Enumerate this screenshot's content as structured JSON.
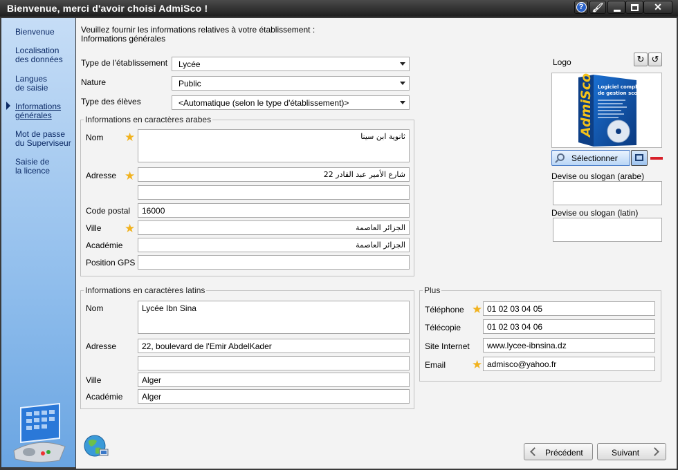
{
  "window": {
    "title": "Bienvenue, merci d'avoir choisi AdmiSco !"
  },
  "titlebar_icons": [
    "help-icon",
    "skin-brush-icon",
    "minimize-icon",
    "maximize-icon",
    "close-icon"
  ],
  "help_glyph": "?",
  "skin_glyph": "🖌",
  "close_glyph": "✕",
  "sidebar": {
    "items": [
      {
        "line1": "Bienvenue",
        "line2": ""
      },
      {
        "line1": "Localisation",
        "line2": "des données"
      },
      {
        "line1": "Langues",
        "line2": "de saisie"
      },
      {
        "line1": "Informations",
        "line2": "générales"
      },
      {
        "line1": "Mot de passe",
        "line2": "du Superviseur"
      },
      {
        "line1": "Saisie de",
        "line2": "la licence"
      }
    ],
    "active_index": 3
  },
  "intro": {
    "line1": "Veuillez fournir les informations relatives à votre établissement :",
    "line2": "Informations générales"
  },
  "general": {
    "type_label": "Type de l'établissement",
    "type_value": "Lycée",
    "nature_label": "Nature",
    "nature_value": "Public",
    "eleves_label": "Type des élèves",
    "eleves_value": "<Automatique (selon le type d'établissement)>"
  },
  "arabic": {
    "title": "Informations en caractères arabes",
    "nom_label": "Nom",
    "nom_value": "ثانوية ابن سينا",
    "adresse_label": "Adresse",
    "adresse_value": "شارع الأمير عبد القادر 22",
    "adresse2_value": "",
    "code_postal_label": "Code postal",
    "code_postal_value": "16000",
    "ville_label": "Ville",
    "ville_value": "الجزائر العاصمة",
    "academie_label": "Académie",
    "academie_value": "الجزائر العاصمة",
    "gps_label": "Position GPS",
    "gps_value": ""
  },
  "latin": {
    "title": "Informations en caractères latins",
    "nom_label": "Nom",
    "nom_value": "Lycée Ibn Sina",
    "adresse_label": "Adresse",
    "adresse_value": "22, boulevard de l'Emir AbdelKader",
    "adresse2_value": "",
    "ville_label": "Ville",
    "ville_value": "Alger",
    "academie_label": "Académie",
    "academie_value": "Alger"
  },
  "plus": {
    "title": "Plus",
    "tel_label": "Téléphone",
    "tel_value": "01 02 03 04 05",
    "fax_label": "Télécopie",
    "fax_value": "01 02 03 04 06",
    "site_label": "Site Internet",
    "site_value": "www.lycee-ibnsina.dz",
    "email_label": "Email",
    "email_value": "admisco@yahoo.fr"
  },
  "logo": {
    "label": "Logo",
    "box_brand": "AdmiSco",
    "box_tagline_1": "Logiciel complet",
    "box_tagline_2": "de gestion scolaire",
    "select_label": "Sélectionner",
    "rotate_right_glyph": "↻",
    "rotate_left_glyph": "↺"
  },
  "slogan": {
    "arabic_label": "Devise ou slogan (arabe)",
    "arabic_value": "",
    "latin_label": "Devise ou slogan (latin)",
    "latin_value": ""
  },
  "footer": {
    "prev_label": "Précédent",
    "next_label": "Suivant"
  },
  "required_star": "★",
  "colors": {
    "sidebar_top": "#c6ddf6",
    "sidebar_bottom": "#6aa5e2",
    "star": "#f1b21e",
    "delete": "#d8202a"
  }
}
